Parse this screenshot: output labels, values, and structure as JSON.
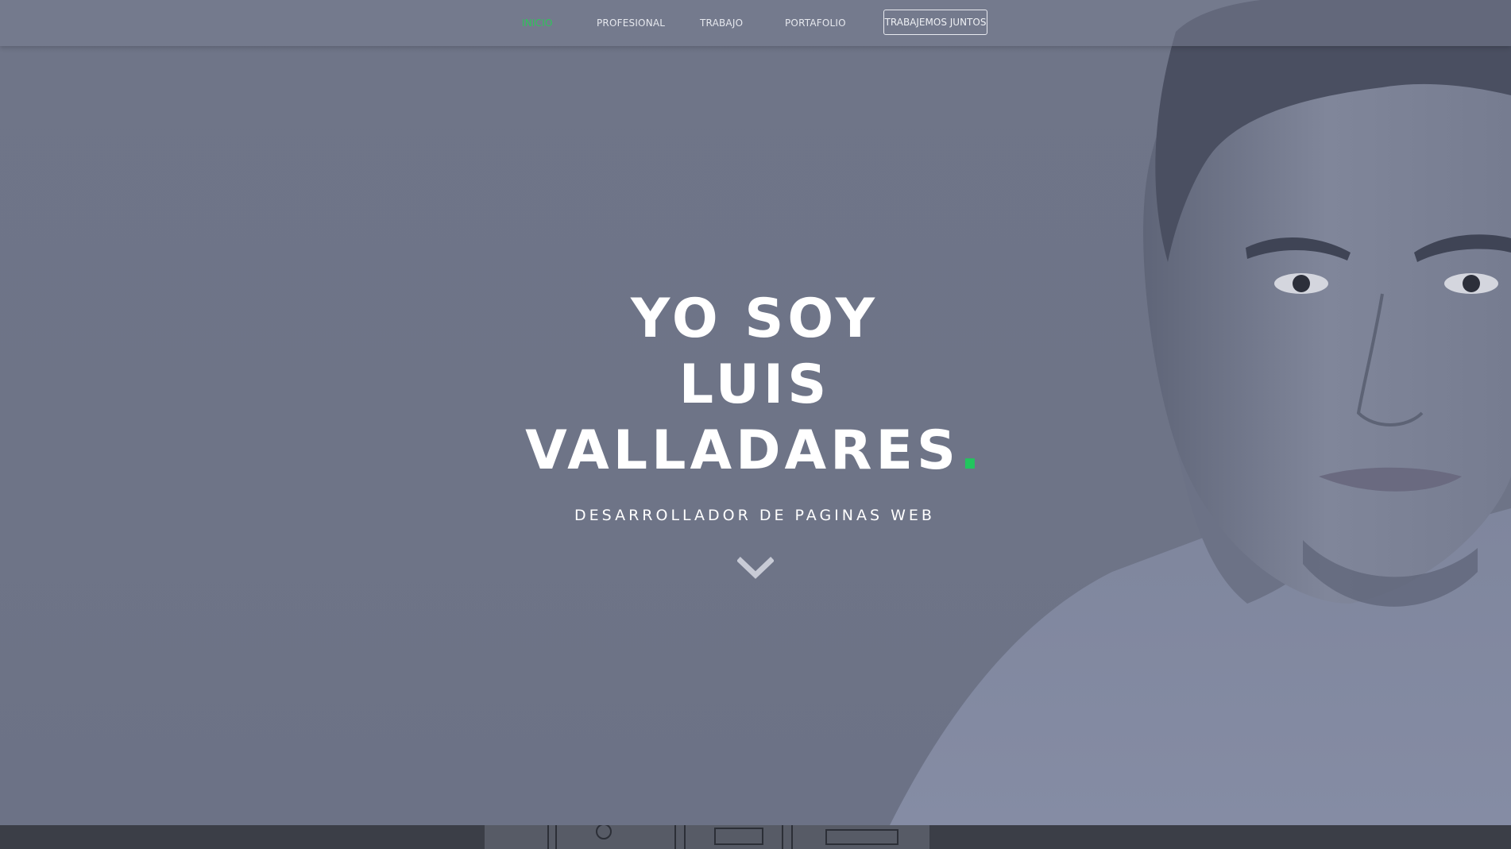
{
  "nav": {
    "items": [
      {
        "label": "INICIO",
        "active": true
      },
      {
        "label": "PROFESIONAL",
        "active": false
      },
      {
        "label": "TRABAJO",
        "active": false
      },
      {
        "label": "PORTAFOLIO",
        "active": false
      }
    ],
    "cta_label": "TRABAJEMOS JUNTOS",
    "active_color": "#2ec55a"
  },
  "hero": {
    "line1": "YO SOY",
    "line2": "LUIS",
    "line3": "VALLADARES",
    "dot": ".",
    "subtitle": "DESARROLLADOR DE PAGINAS WEB",
    "scroll_icon": "chevron-down-icon",
    "accent_color": "#22c55e"
  }
}
